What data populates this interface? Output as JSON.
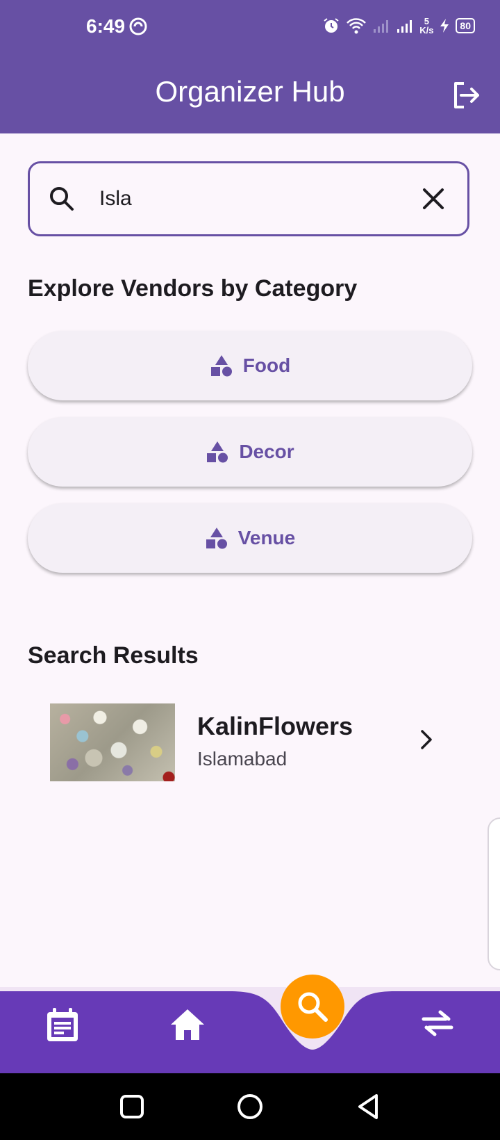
{
  "status_bar": {
    "time": "6:49",
    "network_speed_value": "5",
    "network_speed_unit": "K/s",
    "battery": "80"
  },
  "app_bar": {
    "title": "Organizer Hub"
  },
  "search": {
    "value": "Isla"
  },
  "categories": {
    "title": "Explore Vendors by Category",
    "items": [
      {
        "label": "Food"
      },
      {
        "label": "Decor"
      },
      {
        "label": "Venue"
      }
    ]
  },
  "results": {
    "title": "Search Results",
    "items": [
      {
        "name": "KalinFlowers",
        "city": "Islamabad"
      }
    ]
  },
  "colors": {
    "primary": "#6750a4",
    "nav_bar": "#673ab7",
    "fab": "#ff9800",
    "background": "#fcf6fc"
  },
  "bottom_nav": {
    "items": [
      {
        "icon": "calendar-icon"
      },
      {
        "icon": "home-icon"
      },
      {
        "icon": "search-icon",
        "active": true
      },
      {
        "icon": "swap-icon"
      }
    ]
  }
}
